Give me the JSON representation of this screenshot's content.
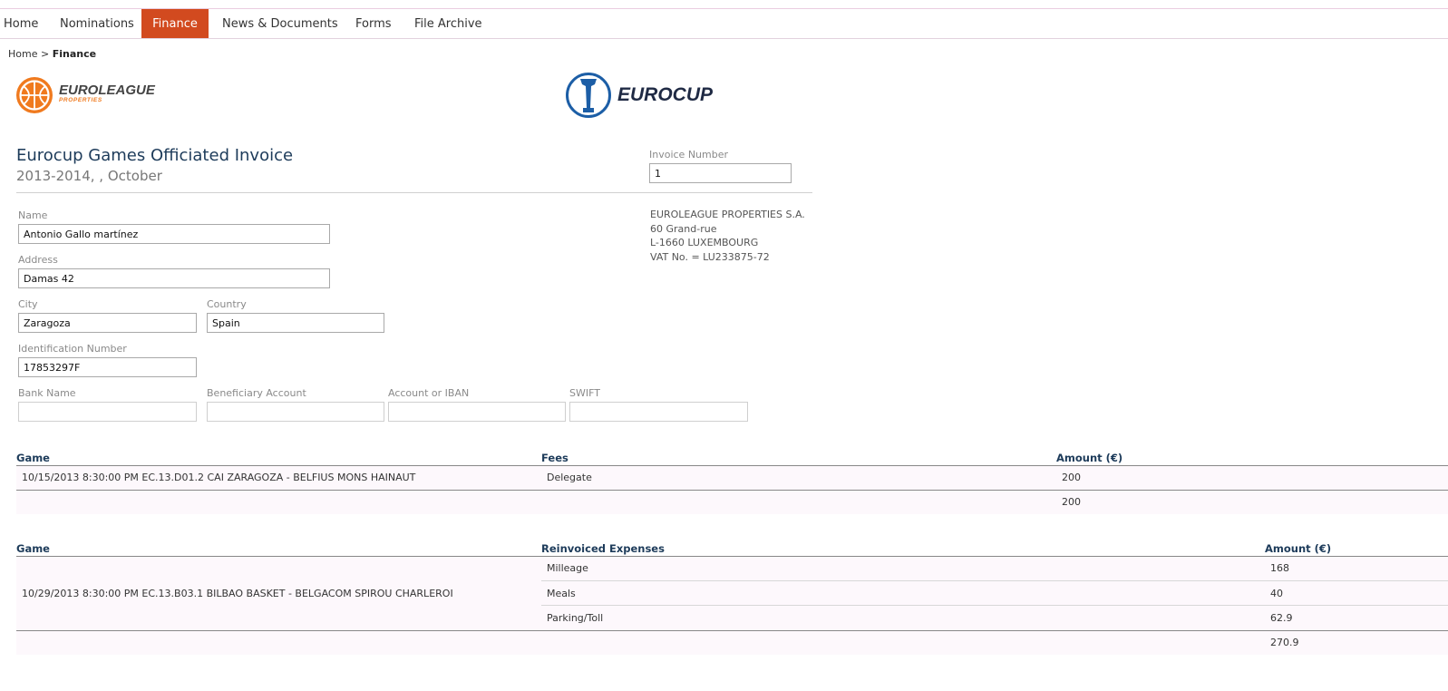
{
  "nav": {
    "items": [
      {
        "label": "Home"
      },
      {
        "label": "Nominations"
      },
      {
        "label": "Finance",
        "active": true
      },
      {
        "label": "News & Documents"
      },
      {
        "label": "Forms"
      },
      {
        "label": "File Archive"
      }
    ]
  },
  "breadcrumb": {
    "home": "Home",
    "separator": ">",
    "current": "Finance"
  },
  "logos": {
    "left": {
      "line1": "EUROLEAGUE",
      "line2": "PROPERTIES"
    },
    "right": {
      "text": "EUROCUP"
    }
  },
  "invoice": {
    "title": "Eurocup Games Officiated Invoice",
    "period": "2013-2014, , October",
    "number_label": "Invoice Number",
    "number_value": "1"
  },
  "company_address": {
    "lines": [
      "EUROLEAGUE PROPERTIES S.A.",
      "60 Grand-rue",
      "L-1660 LUXEMBOURG",
      "VAT No. = LU233875-72"
    ]
  },
  "form": {
    "name": {
      "label": "Name",
      "value": "Antonio Gallo martínez"
    },
    "address": {
      "label": "Address",
      "value": "Damas 42"
    },
    "city": {
      "label": "City",
      "value": "Zaragoza"
    },
    "country": {
      "label": "Country",
      "value": "Spain"
    },
    "id_number": {
      "label": "Identification Number",
      "value": "17853297F"
    },
    "bank_name": {
      "label": "Bank Name",
      "value": ""
    },
    "beneficiary": {
      "label": "Beneficiary Account",
      "value": ""
    },
    "iban": {
      "label": "Account or IBAN",
      "value": ""
    },
    "swift": {
      "label": "SWIFT",
      "value": ""
    }
  },
  "fees_table": {
    "headers": {
      "game": "Game",
      "fees": "Fees",
      "amount": "Amount (€)"
    },
    "rows": [
      {
        "game": "10/15/2013 8:30:00 PM EC.13.D01.2 CAI ZARAGOZA - BELFIUS MONS HAINAUT",
        "fee": "Delegate",
        "amount": "200"
      }
    ],
    "total": "200"
  },
  "expenses_table": {
    "headers": {
      "game": "Game",
      "expenses": "Reinvoiced Expenses",
      "amount": "Amount (€)"
    },
    "game": "10/29/2013 8:30:00 PM EC.13.B03.1 BILBAO BASKET - BELGACOM SPIROU CHARLEROI",
    "rows": [
      {
        "expense": "Milleage",
        "amount": "168"
      },
      {
        "expense": "Meals",
        "amount": "40"
      },
      {
        "expense": "Parking/Toll",
        "amount": "62.9"
      }
    ],
    "total": "270.9"
  },
  "colors": {
    "accent": "#d24a1f",
    "heading": "#1d3b5a",
    "logo_orange": "#f07a1e",
    "logo_blue": "#1c5ea6"
  }
}
